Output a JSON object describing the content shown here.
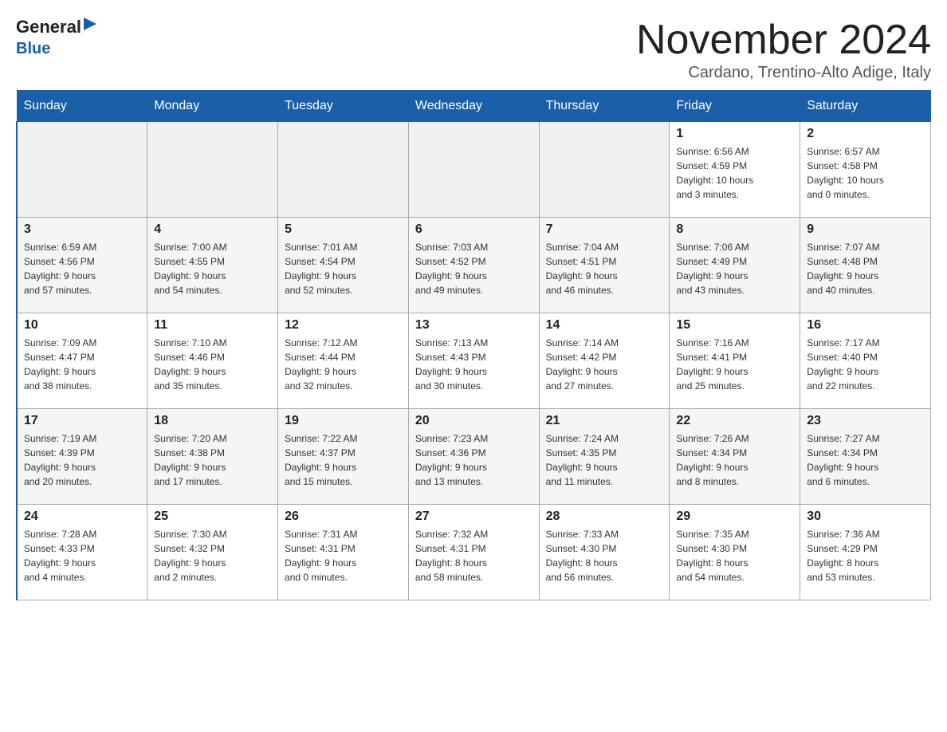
{
  "logo": {
    "general": "General",
    "blue": "Blue"
  },
  "header": {
    "title": "November 2024",
    "location": "Cardano, Trentino-Alto Adige, Italy"
  },
  "days_of_week": [
    "Sunday",
    "Monday",
    "Tuesday",
    "Wednesday",
    "Thursday",
    "Friday",
    "Saturday"
  ],
  "weeks": [
    [
      {
        "day": "",
        "info": ""
      },
      {
        "day": "",
        "info": ""
      },
      {
        "day": "",
        "info": ""
      },
      {
        "day": "",
        "info": ""
      },
      {
        "day": "",
        "info": ""
      },
      {
        "day": "1",
        "info": "Sunrise: 6:56 AM\nSunset: 4:59 PM\nDaylight: 10 hours\nand 3 minutes."
      },
      {
        "day": "2",
        "info": "Sunrise: 6:57 AM\nSunset: 4:58 PM\nDaylight: 10 hours\nand 0 minutes."
      }
    ],
    [
      {
        "day": "3",
        "info": "Sunrise: 6:59 AM\nSunset: 4:56 PM\nDaylight: 9 hours\nand 57 minutes."
      },
      {
        "day": "4",
        "info": "Sunrise: 7:00 AM\nSunset: 4:55 PM\nDaylight: 9 hours\nand 54 minutes."
      },
      {
        "day": "5",
        "info": "Sunrise: 7:01 AM\nSunset: 4:54 PM\nDaylight: 9 hours\nand 52 minutes."
      },
      {
        "day": "6",
        "info": "Sunrise: 7:03 AM\nSunset: 4:52 PM\nDaylight: 9 hours\nand 49 minutes."
      },
      {
        "day": "7",
        "info": "Sunrise: 7:04 AM\nSunset: 4:51 PM\nDaylight: 9 hours\nand 46 minutes."
      },
      {
        "day": "8",
        "info": "Sunrise: 7:06 AM\nSunset: 4:49 PM\nDaylight: 9 hours\nand 43 minutes."
      },
      {
        "day": "9",
        "info": "Sunrise: 7:07 AM\nSunset: 4:48 PM\nDaylight: 9 hours\nand 40 minutes."
      }
    ],
    [
      {
        "day": "10",
        "info": "Sunrise: 7:09 AM\nSunset: 4:47 PM\nDaylight: 9 hours\nand 38 minutes."
      },
      {
        "day": "11",
        "info": "Sunrise: 7:10 AM\nSunset: 4:46 PM\nDaylight: 9 hours\nand 35 minutes."
      },
      {
        "day": "12",
        "info": "Sunrise: 7:12 AM\nSunset: 4:44 PM\nDaylight: 9 hours\nand 32 minutes."
      },
      {
        "day": "13",
        "info": "Sunrise: 7:13 AM\nSunset: 4:43 PM\nDaylight: 9 hours\nand 30 minutes."
      },
      {
        "day": "14",
        "info": "Sunrise: 7:14 AM\nSunset: 4:42 PM\nDaylight: 9 hours\nand 27 minutes."
      },
      {
        "day": "15",
        "info": "Sunrise: 7:16 AM\nSunset: 4:41 PM\nDaylight: 9 hours\nand 25 minutes."
      },
      {
        "day": "16",
        "info": "Sunrise: 7:17 AM\nSunset: 4:40 PM\nDaylight: 9 hours\nand 22 minutes."
      }
    ],
    [
      {
        "day": "17",
        "info": "Sunrise: 7:19 AM\nSunset: 4:39 PM\nDaylight: 9 hours\nand 20 minutes."
      },
      {
        "day": "18",
        "info": "Sunrise: 7:20 AM\nSunset: 4:38 PM\nDaylight: 9 hours\nand 17 minutes."
      },
      {
        "day": "19",
        "info": "Sunrise: 7:22 AM\nSunset: 4:37 PM\nDaylight: 9 hours\nand 15 minutes."
      },
      {
        "day": "20",
        "info": "Sunrise: 7:23 AM\nSunset: 4:36 PM\nDaylight: 9 hours\nand 13 minutes."
      },
      {
        "day": "21",
        "info": "Sunrise: 7:24 AM\nSunset: 4:35 PM\nDaylight: 9 hours\nand 11 minutes."
      },
      {
        "day": "22",
        "info": "Sunrise: 7:26 AM\nSunset: 4:34 PM\nDaylight: 9 hours\nand 8 minutes."
      },
      {
        "day": "23",
        "info": "Sunrise: 7:27 AM\nSunset: 4:34 PM\nDaylight: 9 hours\nand 6 minutes."
      }
    ],
    [
      {
        "day": "24",
        "info": "Sunrise: 7:28 AM\nSunset: 4:33 PM\nDaylight: 9 hours\nand 4 minutes."
      },
      {
        "day": "25",
        "info": "Sunrise: 7:30 AM\nSunset: 4:32 PM\nDaylight: 9 hours\nand 2 minutes."
      },
      {
        "day": "26",
        "info": "Sunrise: 7:31 AM\nSunset: 4:31 PM\nDaylight: 9 hours\nand 0 minutes."
      },
      {
        "day": "27",
        "info": "Sunrise: 7:32 AM\nSunset: 4:31 PM\nDaylight: 8 hours\nand 58 minutes."
      },
      {
        "day": "28",
        "info": "Sunrise: 7:33 AM\nSunset: 4:30 PM\nDaylight: 8 hours\nand 56 minutes."
      },
      {
        "day": "29",
        "info": "Sunrise: 7:35 AM\nSunset: 4:30 PM\nDaylight: 8 hours\nand 54 minutes."
      },
      {
        "day": "30",
        "info": "Sunrise: 7:36 AM\nSunset: 4:29 PM\nDaylight: 8 hours\nand 53 minutes."
      }
    ]
  ]
}
